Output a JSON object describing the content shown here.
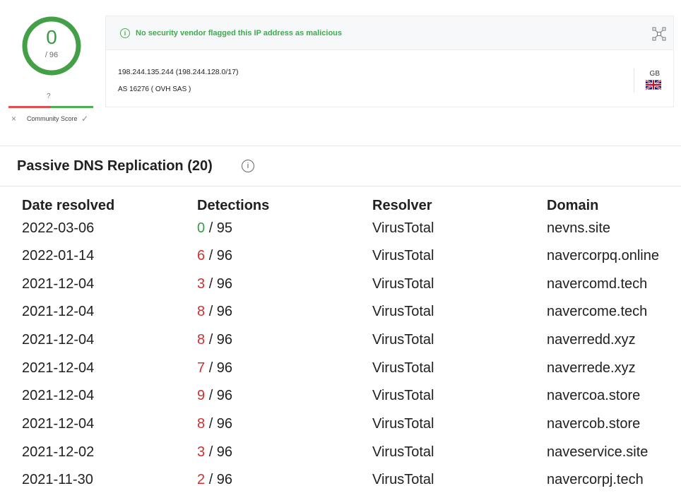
{
  "score": {
    "detections": "0",
    "total": "/ 96",
    "ring_color": "#43a047",
    "community_unknown": "?",
    "community_label": "Community Score",
    "community_bad_icon": "×",
    "community_good_icon": "✓"
  },
  "summary": {
    "info_icon": "i",
    "verdict": "No security vendor flagged this IP address as malicious",
    "ip_line": "198.244.135.244  (198.244.128.0/17)",
    "as_line": "AS 16276 ( OVH SAS )",
    "country_code": "GB",
    "flag_icon": "uk-flag-icon",
    "graph_icon": "graph-icon"
  },
  "section": {
    "title": "Passive DNS Replication (20)",
    "info_icon": "i"
  },
  "table": {
    "headers": [
      "Date resolved",
      "Detections",
      "Resolver",
      "Domain"
    ],
    "rows": [
      {
        "date": "2022-03-06",
        "det": "0",
        "total": "/ 95",
        "resolver": "VirusTotal",
        "domain": "nevns.site"
      },
      {
        "date": "2022-01-14",
        "det": "6",
        "total": "/ 96",
        "resolver": "VirusTotal",
        "domain": "navercorpq.online"
      },
      {
        "date": "2021-12-04",
        "det": "3",
        "total": "/ 96",
        "resolver": "VirusTotal",
        "domain": "navercomd.tech"
      },
      {
        "date": "2021-12-04",
        "det": "8",
        "total": "/ 96",
        "resolver": "VirusTotal",
        "domain": "navercome.tech"
      },
      {
        "date": "2021-12-04",
        "det": "8",
        "total": "/ 96",
        "resolver": "VirusTotal",
        "domain": "naverredd.xyz"
      },
      {
        "date": "2021-12-04",
        "det": "7",
        "total": "/ 96",
        "resolver": "VirusTotal",
        "domain": "naverrede.xyz"
      },
      {
        "date": "2021-12-04",
        "det": "9",
        "total": "/ 96",
        "resolver": "VirusTotal",
        "domain": "navercoa.store"
      },
      {
        "date": "2021-12-04",
        "det": "8",
        "total": "/ 96",
        "resolver": "VirusTotal",
        "domain": "navercob.store"
      },
      {
        "date": "2021-12-02",
        "det": "3",
        "total": "/ 96",
        "resolver": "VirusTotal",
        "domain": "naveservice.site"
      },
      {
        "date": "2021-11-30",
        "det": "2",
        "total": "/ 96",
        "resolver": "VirusTotal",
        "domain": "navercorpj.tech"
      }
    ]
  },
  "colors": {
    "detection_positive": "#d32f2f",
    "detection_zero": "#3c9a47",
    "verdict_green": "#3daa4f"
  }
}
